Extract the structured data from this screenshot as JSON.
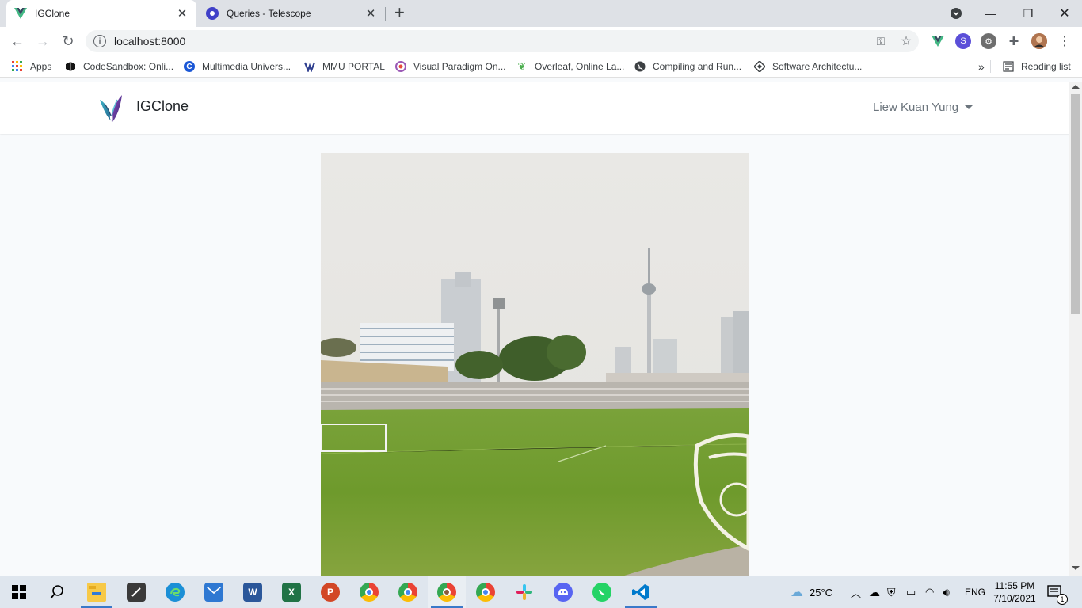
{
  "browser": {
    "tabs": [
      {
        "title": "IGClone",
        "active": true
      },
      {
        "title": "Queries - Telescope",
        "active": false
      }
    ],
    "address": "localhost:8000",
    "bookmarks": [
      {
        "label": "Apps",
        "icon": "apps-grid-icon"
      },
      {
        "label": "CodeSandbox: Onli...",
        "icon": "codesandbox-icon"
      },
      {
        "label": "Multimedia Univers...",
        "icon": "mmu-c-icon"
      },
      {
        "label": "MMU PORTAL",
        "icon": "mmu-portal-icon"
      },
      {
        "label": "Visual Paradigm On...",
        "icon": "visual-paradigm-icon"
      },
      {
        "label": "Overleaf, Online La...",
        "icon": "overleaf-icon"
      },
      {
        "label": "Compiling and Run...",
        "icon": "globe-icon"
      },
      {
        "label": "Software Architectu...",
        "icon": "diamond-icon"
      }
    ],
    "reading_list": "Reading list",
    "more_bookmarks": "»"
  },
  "app": {
    "brand": "IGClone",
    "user_name": "Liew Kuan Yung"
  },
  "taskbar": {
    "weather": "25°C",
    "language": "ENG",
    "time": "11:55 PM",
    "date": "7/10/2021",
    "notification_count": "1"
  },
  "colors": {
    "tabstrip": "#dee1e6",
    "page_bg": "#f8fafc",
    "taskbar": "#dfe6ee",
    "vue_green": "#41b883"
  }
}
